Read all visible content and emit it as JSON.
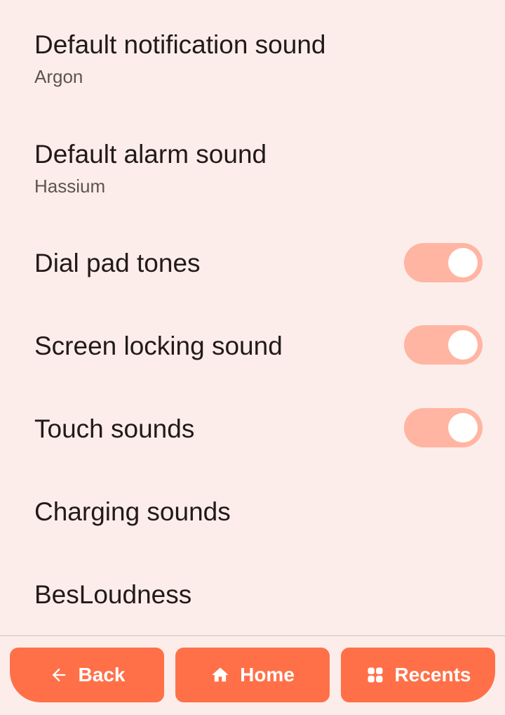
{
  "settings": {
    "items": [
      {
        "title": "Default notification sound",
        "summary": "Argon"
      },
      {
        "title": "Default alarm sound",
        "summary": "Hassium"
      },
      {
        "title": "Dial pad tones",
        "toggle": true
      },
      {
        "title": "Screen locking sound",
        "toggle": true
      },
      {
        "title": "Touch sounds",
        "toggle": true
      },
      {
        "title": "Charging sounds"
      },
      {
        "title": "BesLoudness"
      }
    ]
  },
  "navbar": {
    "back_label": "Back",
    "home_label": "Home",
    "recents_label": "Recents",
    "back_icon": "arrow-left-icon",
    "home_icon": "home-icon",
    "recents_icon": "grid-icon"
  },
  "colors": {
    "background": "#fcedea",
    "accent": "#ff7048",
    "switch_track_on": "#ffb5a2",
    "switch_thumb": "#ffffff",
    "text_primary": "#231a18",
    "text_secondary": "#5d5450"
  }
}
